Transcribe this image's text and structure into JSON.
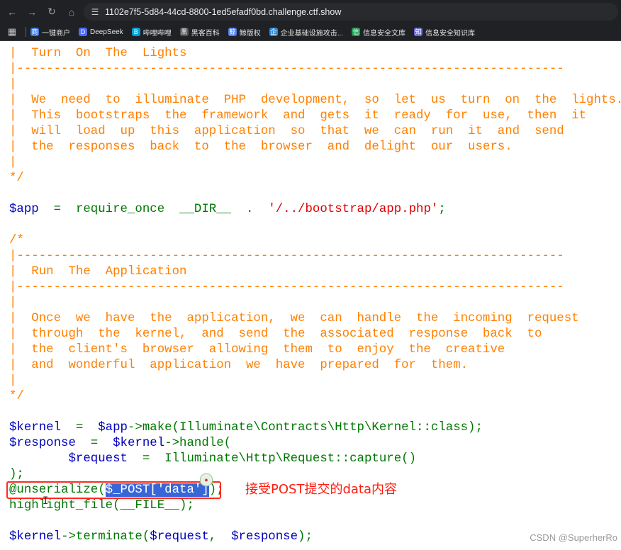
{
  "browser": {
    "url": "1102e7f5-5d84-44cd-8800-1ed5efadf0bd.challenge.ctf.show",
    "bookmarks": [
      {
        "label": "一键商户",
        "color": "#3a78e7",
        "icon": "商"
      },
      {
        "label": "DeepSeek",
        "color": "#4d6bfe",
        "icon": "D"
      },
      {
        "label": "哔哩哔哩",
        "color": "#00a1d6",
        "icon": "B"
      },
      {
        "label": "黑客百科",
        "color": "#555555",
        "icon": "黑"
      },
      {
        "label": "鲸版权",
        "color": "#4c7cf3",
        "icon": "鲸"
      },
      {
        "label": "企业基础设施攻击...",
        "color": "#2f8cd8",
        "icon": "企"
      },
      {
        "label": "信息安全文库",
        "color": "#1f9d55",
        "icon": "信"
      },
      {
        "label": "信息安全知识库",
        "color": "#6b6bd6",
        "icon": "知"
      }
    ]
  },
  "code": {
    "l01": "|  Turn  On  The  Lights",
    "l02": "|--------------------------------------------------------------------------",
    "l03": "|",
    "l04": "|  We  need  to  illuminate  PHP  development,  so  let  us  turn  on  the  lights.",
    "l05": "|  This  bootstraps  the  framework  and  gets  it  ready  for  use,  then  it",
    "l06": "|  will  load  up  this  application  so  that  we  can  run  it  and  send",
    "l07": "|  the  responses  back  to  the  browser  and  delight  our  users.",
    "l08": "|",
    "l09": "*/",
    "l11_var": "$app",
    "l11_op1": "  =  ",
    "l11_fn": "require_once  __DIR__  .  ",
    "l11_str": "'/../bootstrap/app.php'",
    "l11_end": ";",
    "l13": "/*",
    "l14": "|--------------------------------------------------------------------------",
    "l15": "|  Run  The  Application",
    "l16": "|--------------------------------------------------------------------------",
    "l17": "|",
    "l18": "|  Once  we  have  the  application,  we  can  handle  the  incoming  request",
    "l19": "|  through  the  kernel,  and  send  the  associated  response  back  to",
    "l20": "|  the  client's  browser  allowing  them  to  enjoy  the  creative",
    "l21": "|  and  wonderful  application  we  have  prepared  for  them.",
    "l22": "|",
    "l23": "*/",
    "l25_var": "$kernel",
    "l25_op": "  =  ",
    "l25_var2": "$app",
    "l25_rest": "->make(Illuminate\\Contracts\\Http\\Kernel::class);",
    "l26_var": "$response",
    "l26_op": "  =  ",
    "l26_var2": "$kernel",
    "l26_rest": "->handle(",
    "l27_indent": "        ",
    "l27_var": "$request",
    "l27_rest": "  =  Illuminate\\Http\\Request::capture()",
    "l28": ");",
    "l29_a": "@unserialize(",
    "l29_sel": "$_POST['data']",
    "l29_b": ");",
    "l30": "highlight_file(__FILE__);",
    "l32_var": "$kernel",
    "l32_mid": "->terminate(",
    "l32_var2": "$request",
    "l32_comma": ",  ",
    "l32_var3": "$response",
    "l32_end": ");"
  },
  "annotation": {
    "note": "接受POST提交的data内容",
    "box_color": "#ff2a1f"
  },
  "watermark": "CSDN @SuperherRo"
}
